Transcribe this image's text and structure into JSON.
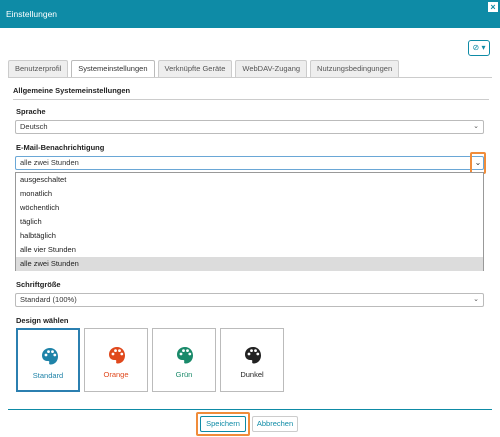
{
  "window": {
    "title": "Einstellungen",
    "close_glyph": "×"
  },
  "help": {
    "glyph": "⊘ ▾"
  },
  "tabs": [
    {
      "label": "Benutzerprofil"
    },
    {
      "label": "Systemeinstellungen"
    },
    {
      "label": "Verknüpfte Geräte"
    },
    {
      "label": "WebDAV-Zugang"
    },
    {
      "label": "Nutzungsbedingungen"
    }
  ],
  "active_tab": "Systemeinstellungen",
  "section": {
    "title": "Allgemeine Systemeinstellungen"
  },
  "language": {
    "label": "Sprache",
    "value": "Deutsch"
  },
  "email": {
    "label": "E-Mail-Benachrichtigung",
    "value": "alle zwei Stunden",
    "options": [
      "ausgeschaltet",
      "monatlich",
      "wöchentlich",
      "täglich",
      "halbtäglich",
      "alle vier Stunden",
      "alle zwei Stunden"
    ],
    "selected": "alle zwei Stunden"
  },
  "fontsize": {
    "label": "Schriftgröße",
    "value": "Standard (100%)"
  },
  "design": {
    "label": "Design wählen",
    "selected": "Standard",
    "themes": [
      {
        "name": "Standard",
        "color": "#1f83a8"
      },
      {
        "name": "Orange",
        "color": "#e0481c"
      },
      {
        "name": "Grün",
        "color": "#1a8a6a"
      },
      {
        "name": "Dunkel",
        "color": "#222222"
      }
    ]
  },
  "buttons": {
    "save": "Speichern",
    "cancel": "Abbrechen"
  },
  "colors": {
    "accent": "#0e8ba6",
    "highlight": "#f08c3a"
  }
}
